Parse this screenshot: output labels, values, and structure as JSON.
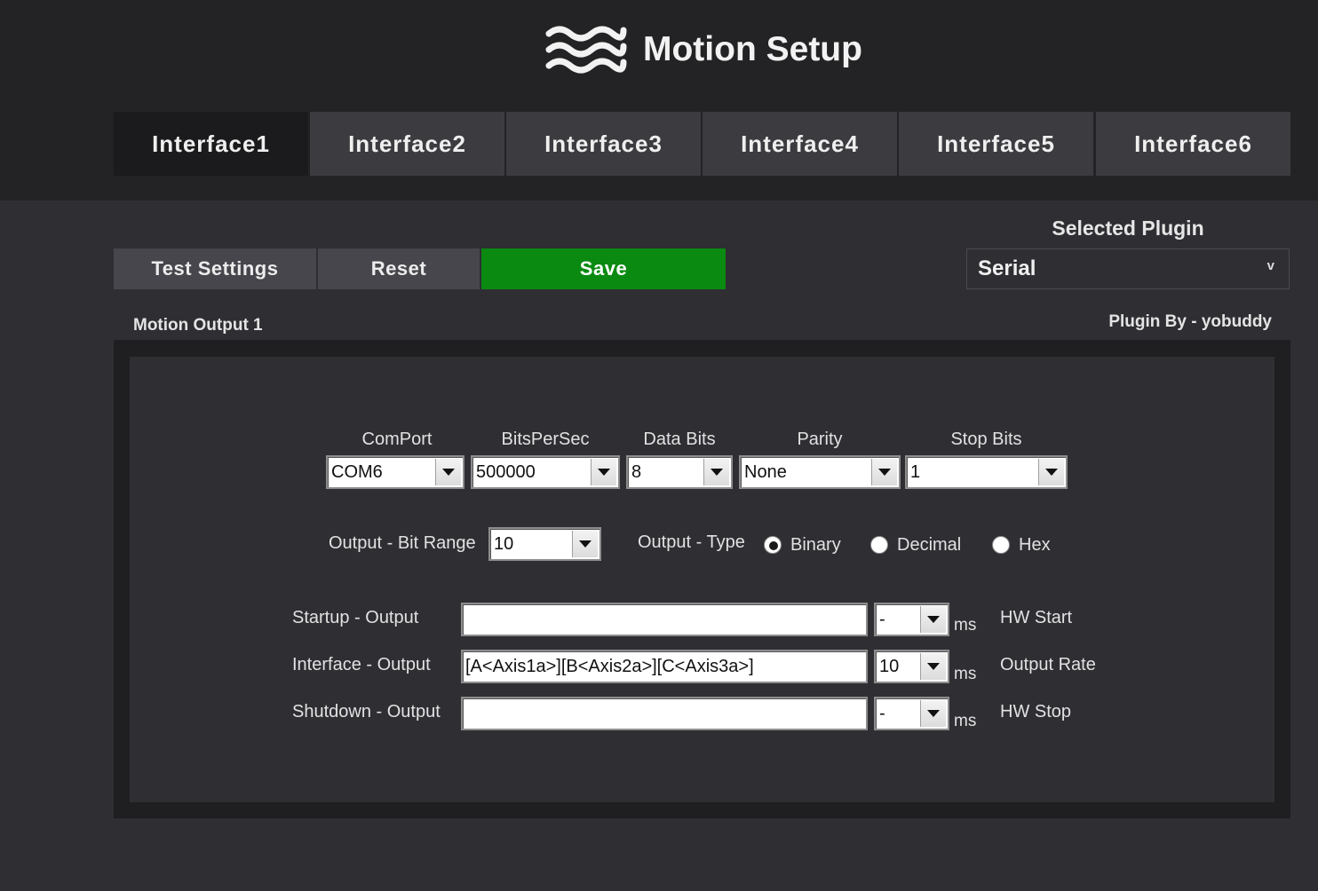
{
  "app": {
    "title": "Motion Setup",
    "logo_icon": "waves-icon"
  },
  "tabs": [
    {
      "label": "Interface1",
      "active": true
    },
    {
      "label": "Interface2",
      "active": false
    },
    {
      "label": "Interface3",
      "active": false
    },
    {
      "label": "Interface4",
      "active": false
    },
    {
      "label": "Interface5",
      "active": false
    },
    {
      "label": "Interface6",
      "active": false
    }
  ],
  "toolbar": {
    "test_label": "Test Settings",
    "reset_label": "Reset",
    "save_label": "Save",
    "save_color": "#0b8a12"
  },
  "plugin": {
    "label": "Selected Plugin",
    "value": "Serial",
    "caret": "v",
    "author": "Plugin By - yobuddy"
  },
  "section": {
    "title": "Motion Output 1"
  },
  "serial": {
    "comport": {
      "label": "ComPort",
      "value": "COM6"
    },
    "bits_per_sec": {
      "label": "BitsPerSec",
      "value": "500000"
    },
    "data_bits": {
      "label": "Data Bits",
      "value": "8"
    },
    "parity": {
      "label": "Parity",
      "value": "None"
    },
    "stop_bits": {
      "label": "Stop Bits",
      "value": "1"
    }
  },
  "output": {
    "bit_range_label": "Output - Bit Range",
    "bit_range_value": "10",
    "type_label": "Output - Type",
    "types": [
      {
        "label": "Binary",
        "checked": true
      },
      {
        "label": "Decimal",
        "checked": false
      },
      {
        "label": "Hex",
        "checked": false
      }
    ]
  },
  "rows": [
    {
      "label": "Startup - Output",
      "value": "",
      "delay": "-",
      "unit": "ms",
      "note": "HW Start"
    },
    {
      "label": "Interface - Output",
      "value": "[A<Axis1a>][B<Axis2a>][C<Axis3a>]",
      "delay": "10",
      "unit": "ms",
      "note": "Output Rate"
    },
    {
      "label": "Shutdown - Output",
      "value": "",
      "delay": "-",
      "unit": "ms",
      "note": "HW Stop"
    }
  ]
}
